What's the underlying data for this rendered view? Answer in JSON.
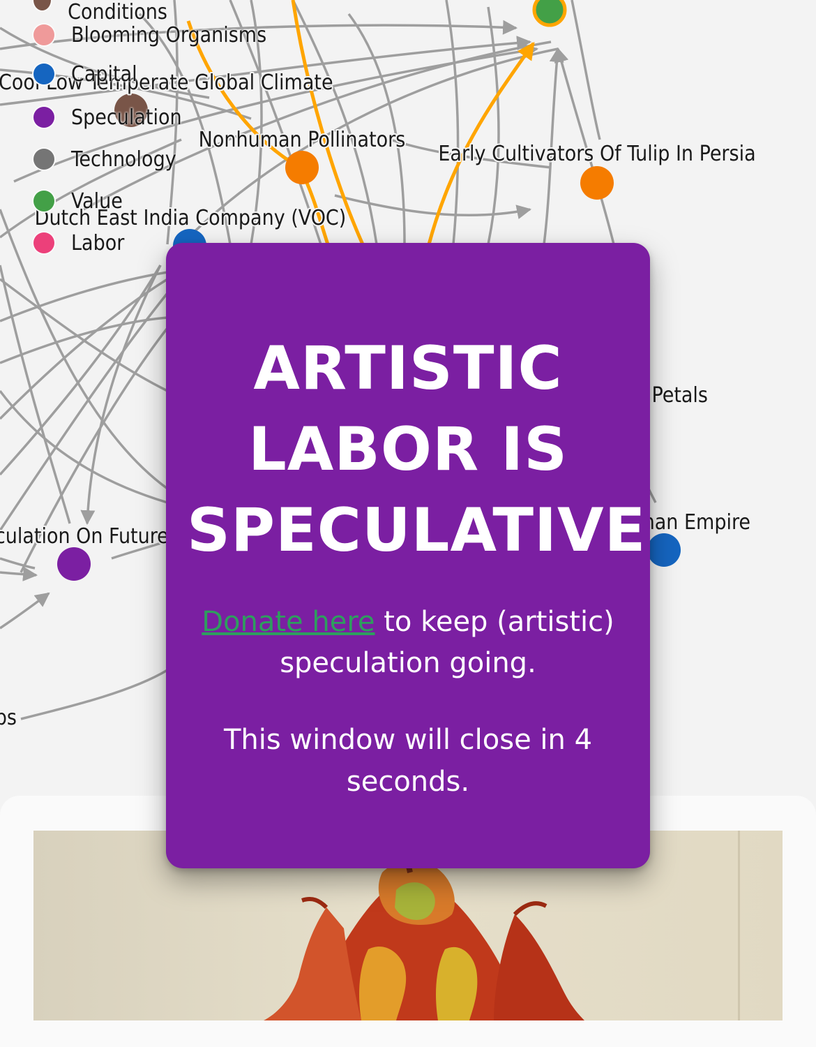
{
  "colors": {
    "background": "#f3f3f3",
    "modal_background": "#7b1fa2",
    "donate_link": "#2e9e5e",
    "edge": "#9e9e9e",
    "highlight_edge": "#ffa500"
  },
  "legend": {
    "items": [
      {
        "label": "Environmental Conditions",
        "color": "#795548"
      },
      {
        "label": "Blooming Organisms",
        "color": "#ef9a9a"
      },
      {
        "label": "Capital",
        "color": "#1565c0"
      },
      {
        "label": "Speculation",
        "color": "#7b1fa2"
      },
      {
        "label": "Technology",
        "color": "#757575"
      },
      {
        "label": "Value",
        "color": "#43a047"
      },
      {
        "label": "Labor",
        "color": "#ec407a"
      }
    ]
  },
  "graph": {
    "node_labels": {
      "cool_climate": "Cool Low Temperate Global Climate",
      "voc": "Dutch East India Company (VOC)",
      "pollinators": "Nonhuman Pollinators",
      "early_cultivators": "Early Cultivators Of Tulip In Persia",
      "petals": "Petals",
      "empire": "Ottoman Empire",
      "future_tulip": "Speculation On Future Tulip Deliveries",
      "partial_left": "Bulbs"
    }
  },
  "modal": {
    "title_line1": "ARTISTIC",
    "title_line2": "LABOR IS",
    "title_line3": "SPECULATIVE",
    "donate_link_text": "Donate here",
    "donate_text_rest": " to keep (artistic) speculation going.",
    "timer_text": "This window will close in 4 seconds."
  },
  "card": {
    "image_alt": "tulip-illustration"
  }
}
